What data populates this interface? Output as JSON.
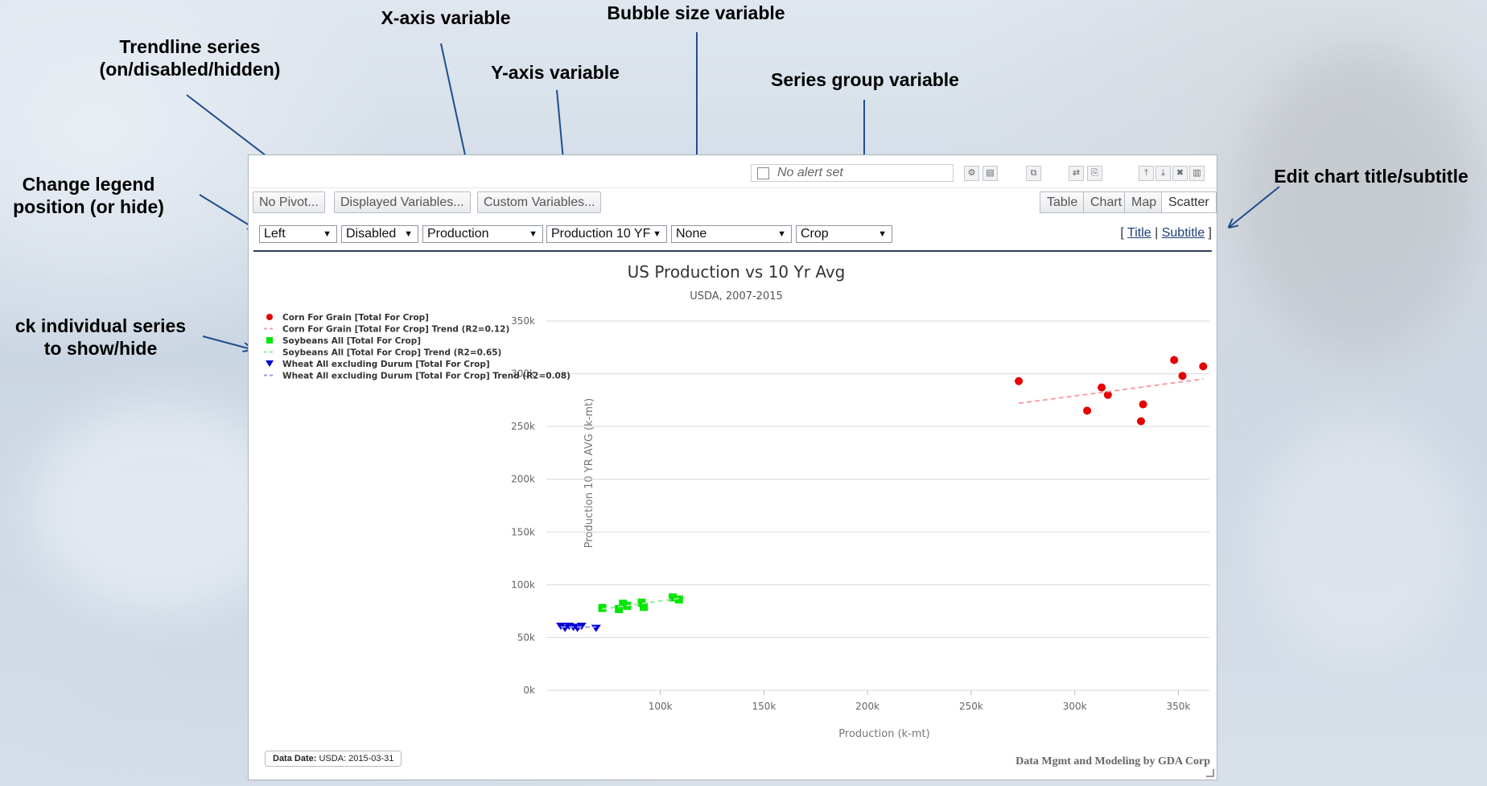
{
  "annotations": {
    "trendline": "Trendline series\n(on/disabled/hidden)",
    "xaxis": "X-axis variable",
    "yaxis": "Y-axis variable",
    "bubble": "Bubble size variable",
    "series_group": "Series group variable",
    "legend_pos": "Change legend\nposition (or hide)",
    "edit_title": "Edit chart title/subtitle",
    "click_series": "ck individual series\nto show/hide"
  },
  "toolbar": {
    "alert_text": "No alert set"
  },
  "buttons": {
    "no_pivot": "No Pivot...",
    "displayed_vars": "Displayed Variables...",
    "custom_vars": "Custom Variables..."
  },
  "view_tabs": [
    "Table",
    "Chart",
    "Map",
    "Scatter"
  ],
  "selects": {
    "legend": "Left",
    "trendline": "Disabled",
    "xvar": "Production",
    "yvar": "Production 10 YF",
    "bubble": "None",
    "group": "Crop",
    "arrow": "▼"
  },
  "title_links": {
    "open": "[",
    "title": "Title",
    "sep": "|",
    "subtitle": "Subtitle",
    "close": "]"
  },
  "footer": {
    "data_date_label": "Data Date:",
    "data_date_value": "USDA: 2015-03-31",
    "credit": "Data Mgmt and Modeling by GDA Corp"
  },
  "colors": {
    "corn": "#e60000",
    "soy": "#00e600",
    "wheat": "#0000d6",
    "corn_trend": "#f4a0a8",
    "soy_trend": "#9fe89f",
    "wheat_trend": "#9a9aef"
  },
  "chart_data": {
    "type": "scatter",
    "title": "US Production vs 10 Yr Avg",
    "subtitle": "USDA, 2007-2015",
    "xlabel": "Production (k-mt)",
    "ylabel": "Production 10 YR AVG (k-mt)",
    "xlim": [
      45000,
      365000
    ],
    "ylim": [
      0,
      350000
    ],
    "x_ticks": [
      100000,
      150000,
      200000,
      250000,
      300000,
      350000
    ],
    "x_tick_labels": [
      "100k",
      "150k",
      "200k",
      "250k",
      "300k",
      "350k"
    ],
    "y_ticks": [
      0,
      50000,
      100000,
      150000,
      200000,
      250000,
      300000,
      350000
    ],
    "y_tick_labels": [
      "0k",
      "50k",
      "100k",
      "150k",
      "200k",
      "250k",
      "300k",
      "350k"
    ],
    "grid": true,
    "legend_position": "left",
    "series": [
      {
        "name": "Corn For Grain [Total For Crop]",
        "marker": "circle",
        "color": "#e60000",
        "points": [
          [
            273000,
            293000
          ],
          [
            306000,
            265000
          ],
          [
            313000,
            287000
          ],
          [
            316000,
            280000
          ],
          [
            332000,
            255000
          ],
          [
            333000,
            271000
          ],
          [
            348000,
            313000
          ],
          [
            352000,
            298000
          ],
          [
            362000,
            307000
          ]
        ]
      },
      {
        "name": "Corn For Grain [Total For Crop] Trend (R2=0.12)",
        "marker": "dash",
        "color": "#f4a0a8",
        "points": [
          [
            273000,
            272000
          ],
          [
            362000,
            295000
          ]
        ]
      },
      {
        "name": "Soybeans All [Total For Crop]",
        "marker": "square",
        "color": "#00e600",
        "points": [
          [
            72000,
            78000
          ],
          [
            80000,
            77000
          ],
          [
            82000,
            82000
          ],
          [
            84000,
            80000
          ],
          [
            91000,
            83000
          ],
          [
            92000,
            79000
          ],
          [
            106000,
            88000
          ],
          [
            109000,
            86000
          ]
        ]
      },
      {
        "name": "Soybeans All [Total For Crop] Trend (R2=0.65)",
        "marker": "dash",
        "color": "#9fe89f",
        "points": [
          [
            72000,
            77000
          ],
          [
            109000,
            87000
          ]
        ]
      },
      {
        "name": "Wheat All excluding Durum [Total For Crop]",
        "marker": "triangle-down",
        "color": "#0000d6",
        "points": [
          [
            52000,
            61000
          ],
          [
            54000,
            59000
          ],
          [
            56000,
            61000
          ],
          [
            58000,
            60000
          ],
          [
            60000,
            59000
          ],
          [
            62000,
            61000
          ],
          [
            69000,
            59000
          ]
        ]
      },
      {
        "name": "Wheat All excluding Durum [Total For Crop] Trend (R2=0.08)",
        "marker": "dash",
        "color": "#9a9aef",
        "points": [
          [
            52000,
            60000
          ],
          [
            69000,
            60000
          ]
        ]
      }
    ]
  }
}
